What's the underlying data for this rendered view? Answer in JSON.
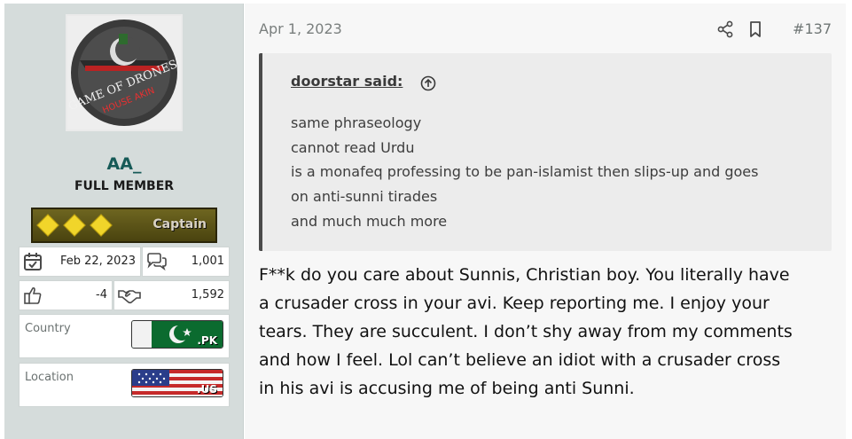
{
  "user": {
    "avatar_text": "GAME OF DRONES",
    "avatar_subtext": "HOUSE AKIN",
    "name": "AA_",
    "title": "FULL MEMBER",
    "rank_label": "Captain"
  },
  "stats": {
    "joined": "Feb 22, 2023",
    "messages": "1,001",
    "reaction_score": "-4",
    "points": "1,592"
  },
  "info": {
    "country_label": "Country",
    "country_tld": ".PK",
    "location_label": "Location",
    "location_tld": ".US"
  },
  "post": {
    "date": "Apr 1, 2023",
    "number": "#137",
    "quote_author": "doorstar said:",
    "quote_lines": [
      "same phraseology",
      "cannot read Urdu",
      "is a monafeq professing to be pan-islamist then slips-up and goes",
      "on anti-sunni tirades",
      "and much much more"
    ],
    "message_lines": [
      "F**k do you care about Sunnis, Christian boy. You literally have",
      "a crusader cross in your avi. Keep reporting me. I enjoy your",
      "tears. They are succulent. I don’t shy away from my comments",
      "and how I feel. Lol can’t believe an idiot with a crusader cross",
      "in his avi is accusing me of being anti Sunni."
    ]
  },
  "colors": {
    "sidebar_bg": "#d5dcdb",
    "username": "#165a57",
    "quote_bg": "#ececec"
  }
}
